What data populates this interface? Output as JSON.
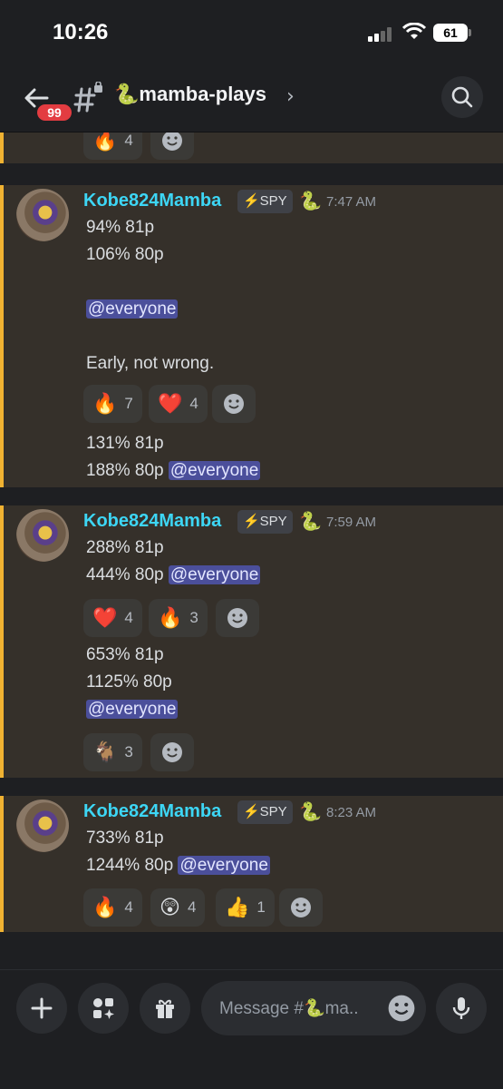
{
  "status": {
    "time": "10:26",
    "battery": "61"
  },
  "header": {
    "badge": "99",
    "channel_name": "🐍mamba-plays",
    "chevron": "›"
  },
  "top_partial": {
    "reactions": [
      {
        "emoji": "🔥",
        "count": "4"
      }
    ]
  },
  "messages": [
    {
      "author": "Kobe824Mamba",
      "tag": "⚡SPY",
      "role_emoji": "🐍",
      "time": "7:47 AM",
      "lines": [
        "94% 81p",
        "106% 80p",
        "@everyone",
        "Early, not wrong."
      ],
      "reactions": [
        {
          "emoji": "🔥",
          "count": "7"
        },
        {
          "emoji": "❤️",
          "count": "4"
        }
      ],
      "followup_lines": [
        "131% 81p",
        "188% 80p"
      ],
      "followup_mention": "@everyone"
    },
    {
      "author": "Kobe824Mamba",
      "tag": "⚡SPY",
      "role_emoji": "🐍",
      "time": "7:59 AM",
      "lines": [
        "288% 81p",
        "444% 80p"
      ],
      "line_mention": "@everyone",
      "reactions": [
        {
          "emoji": "❤️",
          "count": "4"
        },
        {
          "emoji": "🔥",
          "count": "3"
        }
      ],
      "followup_lines": [
        "653% 81p",
        "1125% 80p"
      ],
      "followup_mention": "@everyone",
      "followup_reactions": [
        {
          "emoji": "🐐",
          "count": "3"
        }
      ]
    },
    {
      "author": "Kobe824Mamba",
      "tag": "⚡SPY",
      "role_emoji": "🐍",
      "time": "8:23 AM",
      "lines": [
        "733% 81p",
        "1244% 80p"
      ],
      "line_mention": "@everyone",
      "reactions": [
        {
          "emoji": "🔥",
          "count": "4"
        },
        {
          "emoji": "😲",
          "count": "4"
        },
        {
          "emoji": "👍",
          "count": "1"
        }
      ]
    }
  ],
  "composer": {
    "placeholder": "Message #🐍ma.."
  },
  "colors": {
    "accent_bar": "#f0b232",
    "author": "#3dd6f5",
    "mention_bg": "#4b4f9b",
    "badge": "#e33c41"
  }
}
